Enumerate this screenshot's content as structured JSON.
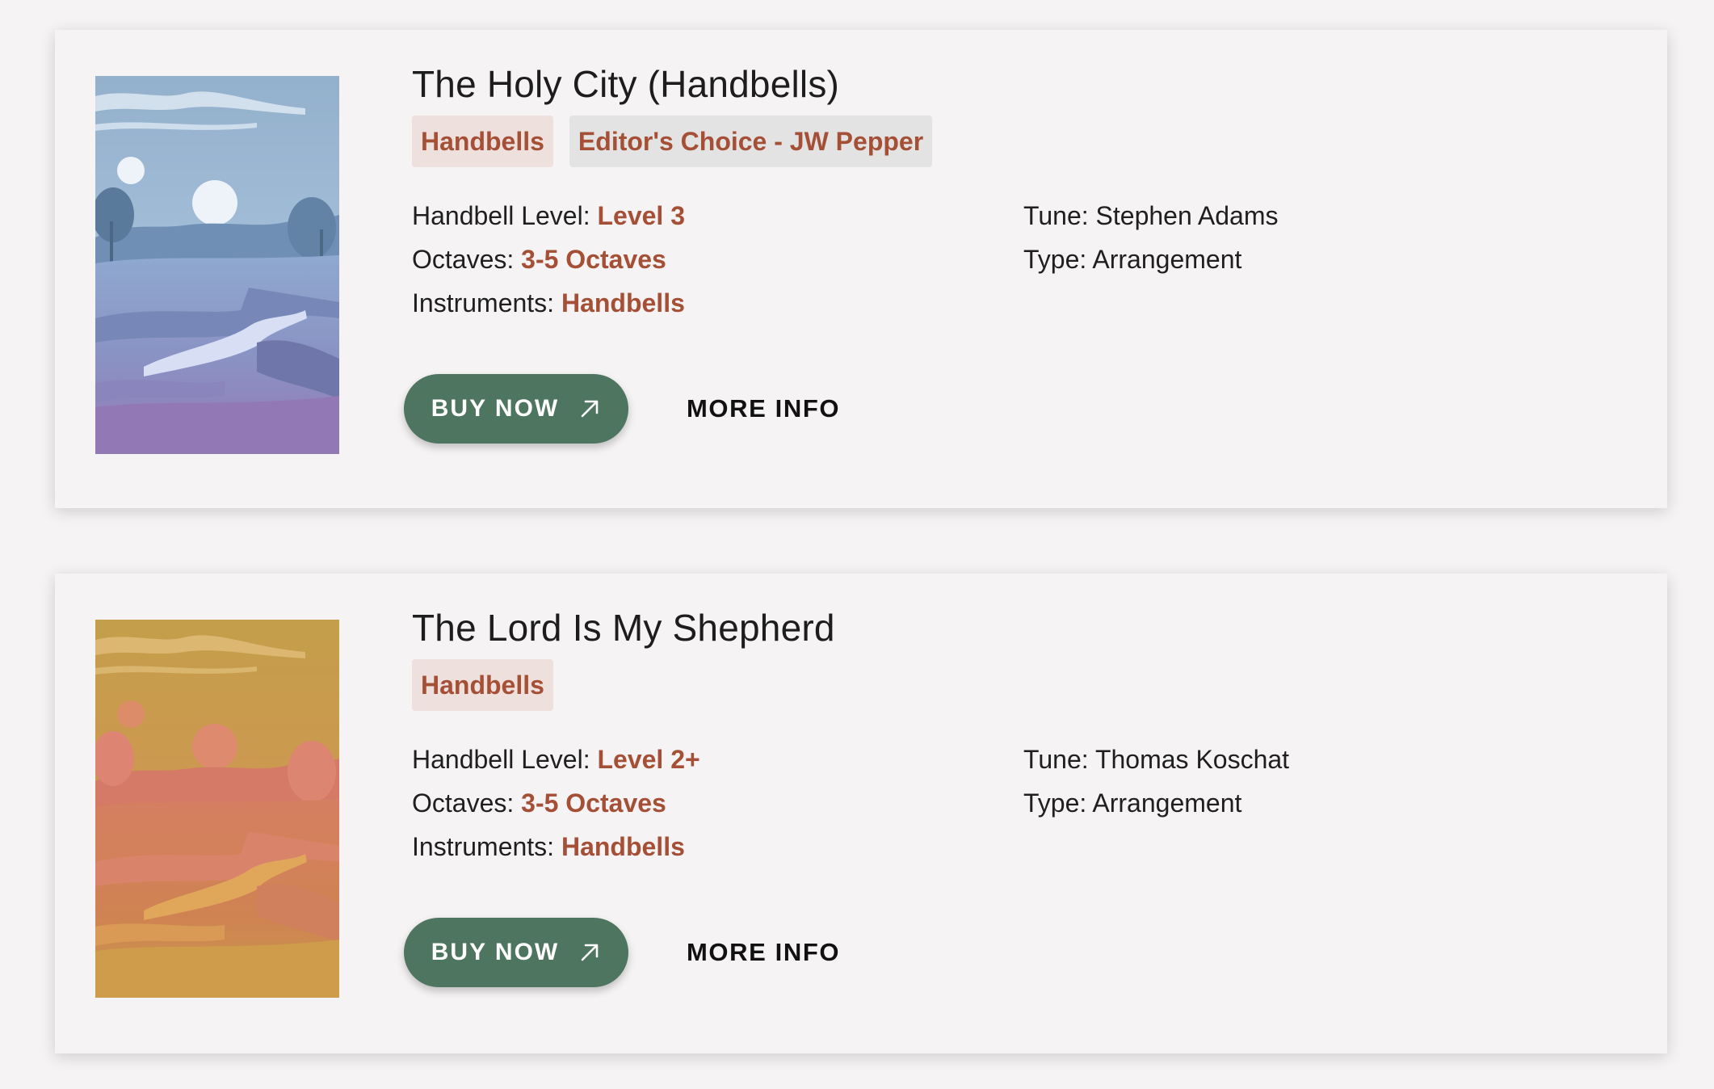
{
  "products": [
    {
      "title": "The Holy City (Handbells)",
      "tags": [
        "Handbells",
        "Editor's Choice - JW Pepper"
      ],
      "details_left": [
        {
          "label": "Handbell Level: ",
          "value": "Level 3"
        },
        {
          "label": "Octaves: ",
          "value": "3-5 Octaves"
        },
        {
          "label": "Instruments: ",
          "value": "Handbells"
        }
      ],
      "details_right": [
        {
          "label": "Tune: ",
          "value": "Stephen Adams"
        },
        {
          "label": "Type: ",
          "value": "Arrangement"
        }
      ],
      "buy_label": "BUY NOW",
      "buy_icon": "arrow-up-right-icon",
      "more_label": "MORE INFO",
      "cover_theme": "blue-purple-landscape"
    },
    {
      "title": "The Lord Is My Shepherd",
      "tags": [
        "Handbells"
      ],
      "details_left": [
        {
          "label": "Handbell Level: ",
          "value": "Level 2+"
        },
        {
          "label": "Octaves: ",
          "value": "3-5 Octaves"
        },
        {
          "label": "Instruments: ",
          "value": "Handbells"
        }
      ],
      "details_right": [
        {
          "label": "Tune: ",
          "value": "Thomas Koschat"
        },
        {
          "label": "Type: ",
          "value": "Arrangement"
        }
      ],
      "buy_label": "BUY NOW",
      "buy_icon": "arrow-up-right-icon",
      "more_label": "MORE INFO",
      "cover_theme": "golden-orange-landscape"
    }
  ],
  "colors": {
    "accent": "#a54f36",
    "button_bg": "#4d7560",
    "tag_primary_bg": "#eee0dd",
    "tag_secondary_bg": "#e3e3e3",
    "page_bg": "#f5f3f3"
  }
}
